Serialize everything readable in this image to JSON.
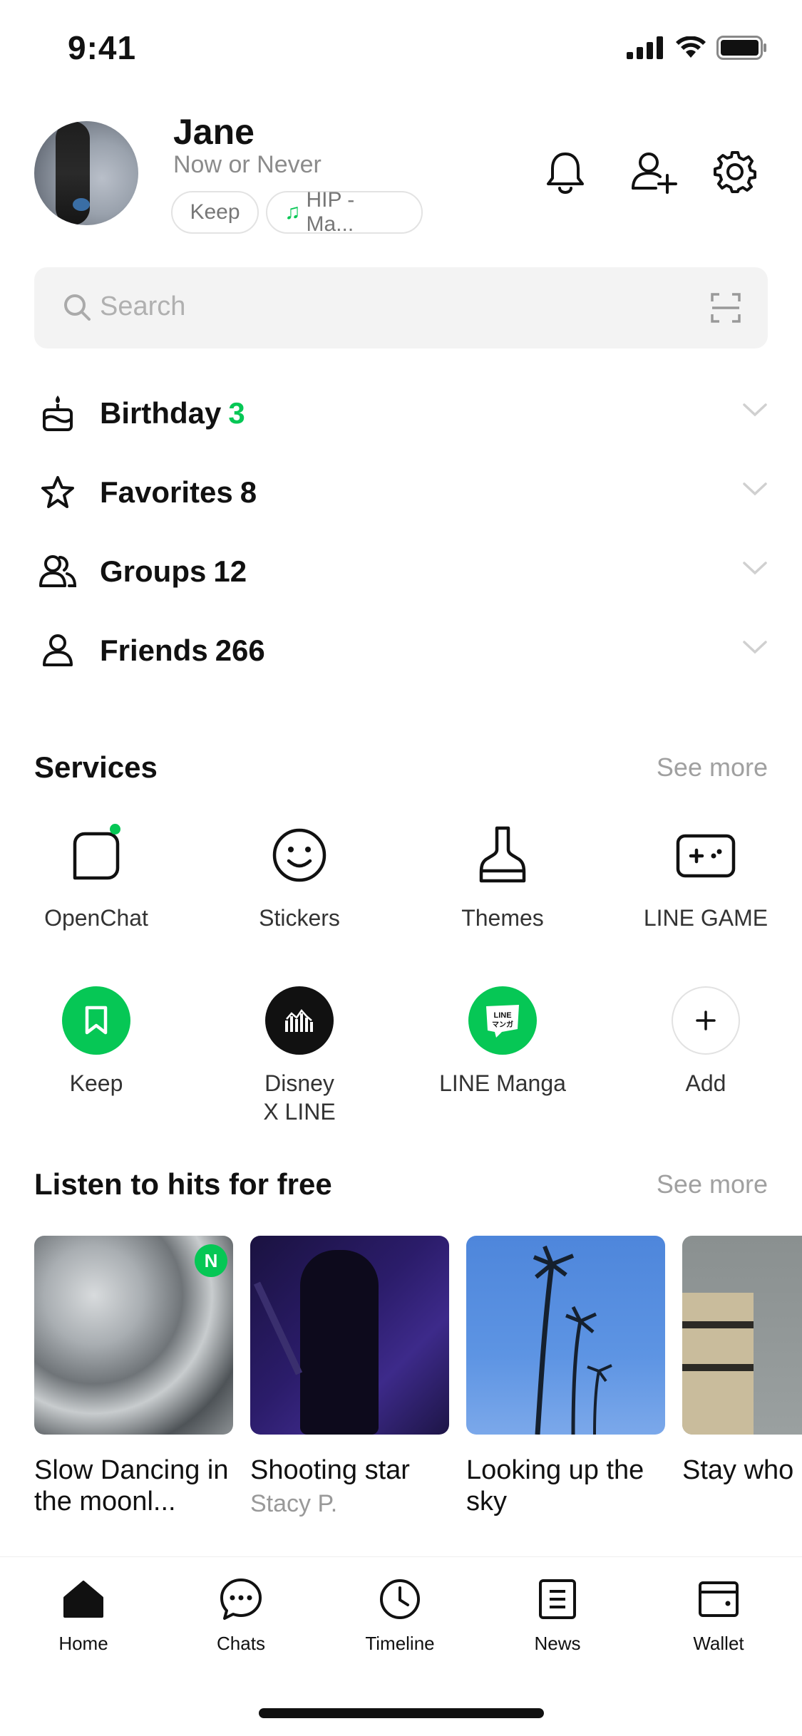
{
  "status_bar": {
    "time": "9:41"
  },
  "profile": {
    "name": "Jane",
    "status_message": "Now or Never",
    "chips": {
      "keep": "Keep",
      "music": "HIP - Ma..."
    }
  },
  "search": {
    "placeholder": "Search"
  },
  "lists": [
    {
      "label": "Birthday",
      "count": "3"
    },
    {
      "label": "Favorites",
      "count": "8"
    },
    {
      "label": "Groups",
      "count": "12"
    },
    {
      "label": "Friends",
      "count": "266"
    }
  ],
  "services": {
    "title": "Services",
    "see_more": "See more",
    "items": [
      {
        "label": "OpenChat",
        "icon": "openchat-icon"
      },
      {
        "label": "Stickers",
        "icon": "smiley-icon"
      },
      {
        "label": "Themes",
        "icon": "brush-icon"
      },
      {
        "label": "LINE GAME",
        "icon": "gamepad-icon"
      },
      {
        "label": "Keep",
        "icon": "bookmark-icon"
      },
      {
        "label": "Disney\nX LINE",
        "icon": "castle-icon"
      },
      {
        "label": "LINE Manga",
        "icon": "manga-icon"
      },
      {
        "label": "Add",
        "icon": "plus-icon"
      }
    ]
  },
  "music": {
    "title": "Listen to hits for free",
    "see_more": "See more",
    "new_badge": "N",
    "cards": [
      {
        "title": "Slow Dancing in the moonl...",
        "artist": ""
      },
      {
        "title": "Shooting star",
        "artist": "Stacy P."
      },
      {
        "title": "Looking up the sky",
        "artist": ""
      },
      {
        "title": "Stay who are",
        "artist": ""
      }
    ]
  },
  "tabbar": {
    "items": [
      {
        "label": "Home"
      },
      {
        "label": "Chats"
      },
      {
        "label": "Timeline"
      },
      {
        "label": "News"
      },
      {
        "label": "Wallet"
      }
    ]
  },
  "colors": {
    "accent": "#06c755",
    "text": "#111111",
    "muted": "#a0a0a0"
  }
}
